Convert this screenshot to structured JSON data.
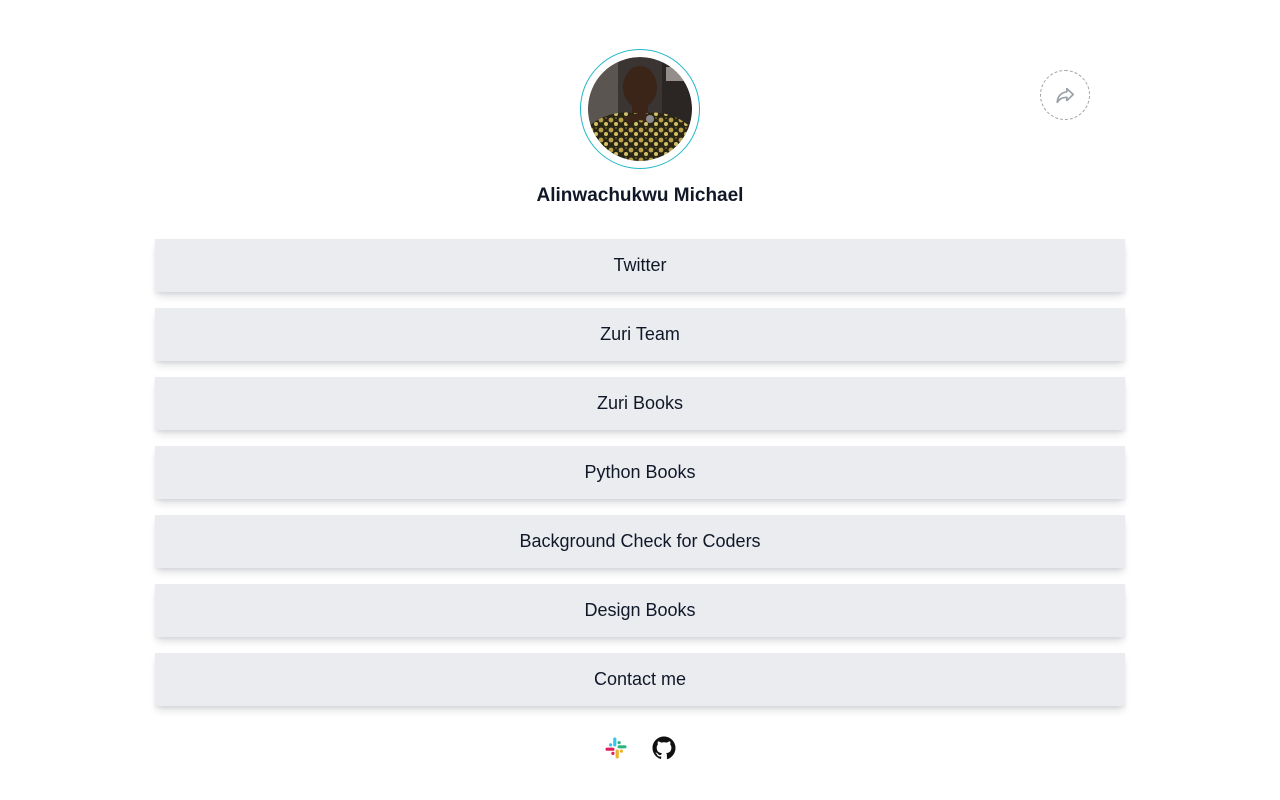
{
  "profile": {
    "name": "Alinwachukwu Michael",
    "avatar_icon": "profile-photo",
    "avatar_ring_color": "#1fb8c9"
  },
  "share": {
    "icon": "share-icon"
  },
  "links": [
    {
      "label": "Twitter"
    },
    {
      "label": "Zuri Team"
    },
    {
      "label": "Zuri Books"
    },
    {
      "label": "Python Books"
    },
    {
      "label": "Background Check for Coders"
    },
    {
      "label": "Design Books"
    },
    {
      "label": "Contact me"
    }
  ],
  "footer": {
    "icons": [
      "slack-icon",
      "github-icon"
    ]
  },
  "colors": {
    "button_bg": "#eaecf0",
    "text": "#101828",
    "accent": "#1fb8c9"
  }
}
